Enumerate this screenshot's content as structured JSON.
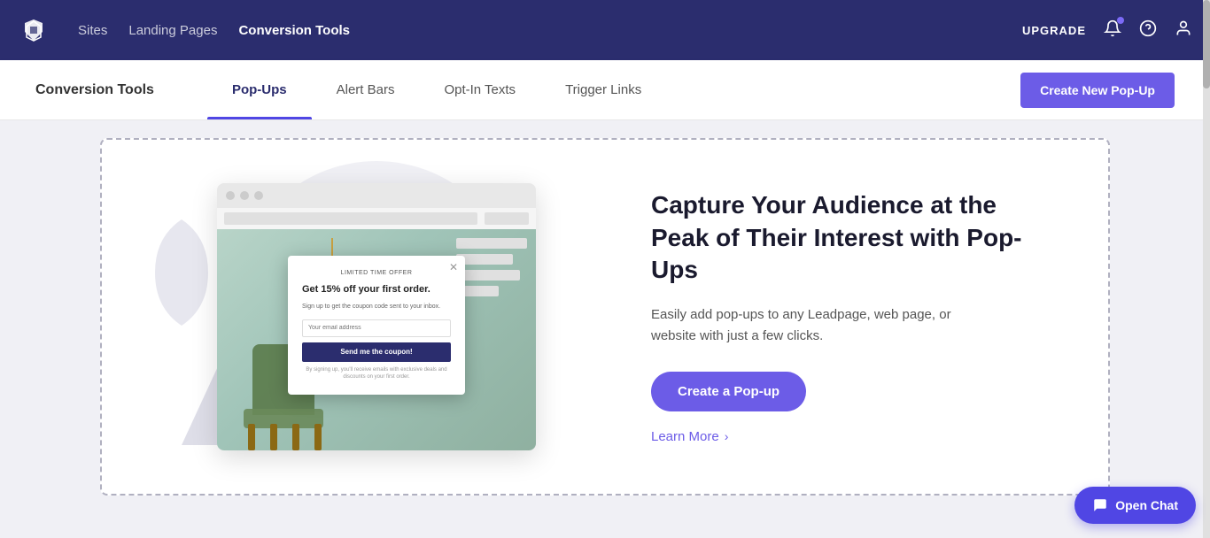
{
  "brand": {
    "name": "Leadpages"
  },
  "top_nav": {
    "links": [
      {
        "id": "sites",
        "label": "Sites",
        "active": false
      },
      {
        "id": "landing-pages",
        "label": "Landing Pages",
        "active": false
      },
      {
        "id": "conversion-tools",
        "label": "Conversion Tools",
        "active": true
      }
    ],
    "upgrade_label": "UPGRADE",
    "notification_icon": "bell",
    "help_icon": "question",
    "user_icon": "user"
  },
  "sub_nav": {
    "title": "Conversion Tools",
    "tabs": [
      {
        "id": "pop-ups",
        "label": "Pop-Ups",
        "active": true
      },
      {
        "id": "alert-bars",
        "label": "Alert Bars",
        "active": false
      },
      {
        "id": "opt-in-texts",
        "label": "Opt-In Texts",
        "active": false
      },
      {
        "id": "trigger-links",
        "label": "Trigger Links",
        "active": false
      }
    ],
    "create_button_label": "Create New Pop-Up"
  },
  "hero": {
    "title": "Capture Your Audience at the Peak of Their Interest with Pop-Ups",
    "description": "Easily add pop-ups to any Leadpage, web page, or website with just a few clicks.",
    "cta_label": "Create a Pop-up",
    "learn_more_label": "Learn More"
  },
  "popup_demo": {
    "badge": "Limited time offer",
    "title": "Get 15% off your first order.",
    "description": "Sign up to get the coupon code sent to your inbox.",
    "input_placeholder": "Your email address",
    "button_label": "Send me the coupon!",
    "fine_print": "By signing up, you'll receive emails with exclusive deals and discounts on your first order."
  },
  "chat": {
    "button_label": "Open Chat"
  }
}
